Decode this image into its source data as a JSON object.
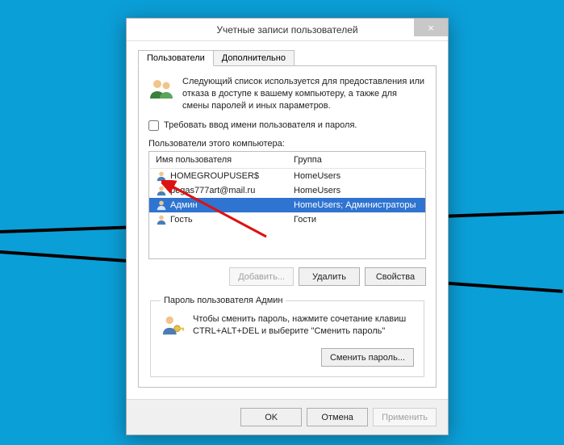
{
  "window": {
    "title": "Учетные записи пользователей",
    "close_label": "×"
  },
  "tabs": {
    "users": "Пользователи",
    "advanced": "Дополнительно"
  },
  "intro_text": "Следующий список используется для предоставления или отказа в доступе к вашему компьютеру, а также для смены паролей и иных параметров.",
  "require_login_label": "Требовать ввод имени пользователя и пароля.",
  "require_login_checked": false,
  "list_label": "Пользователи этого компьютера:",
  "columns": {
    "user": "Имя пользователя",
    "group": "Группа"
  },
  "users": [
    {
      "name": "HOMEGROUPUSER$",
      "group": "HomeUsers",
      "selected": false
    },
    {
      "name": "pegas777art@mail.ru",
      "group": "HomeUsers",
      "selected": false
    },
    {
      "name": "Админ",
      "group": "HomeUsers; Администраторы",
      "selected": true
    },
    {
      "name": "Гость",
      "group": "Гости",
      "selected": false
    }
  ],
  "buttons": {
    "add": "Добавить...",
    "remove": "Удалить",
    "properties": "Свойства"
  },
  "password_section": {
    "legend": "Пароль пользователя Админ",
    "text": "Чтобы сменить пароль, нажмите сочетание клавиш CTRL+ALT+DEL и выберите \"Сменить пароль\"",
    "button": "Сменить пароль..."
  },
  "footer": {
    "ok": "OK",
    "cancel": "Отмена",
    "apply": "Применить"
  }
}
